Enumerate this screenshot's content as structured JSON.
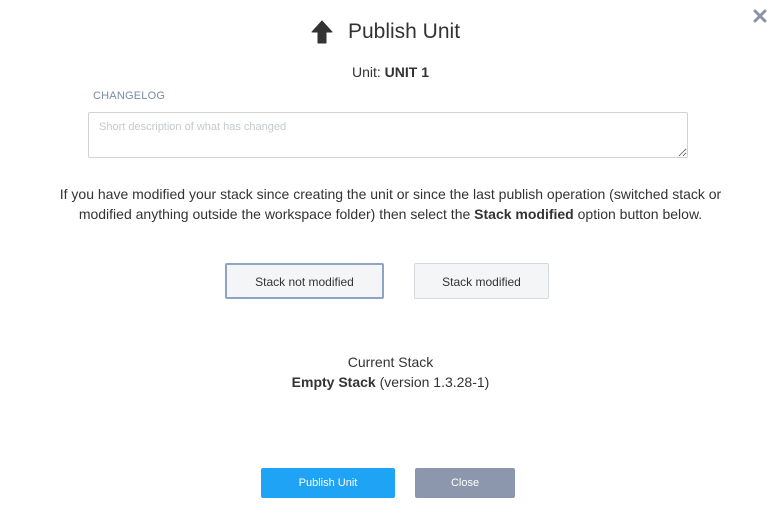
{
  "dialog": {
    "title": "Publish Unit",
    "title_icon": "arrow-up-icon",
    "close_icon": "close-icon"
  },
  "unit": {
    "label": "Unit:",
    "name": "UNIT 1"
  },
  "changelog": {
    "label": "CHANGELOG",
    "value": "",
    "placeholder": "Short description of what has changed"
  },
  "info": {
    "text_before": "If you have modified your stack since creating the unit or since the last publish operation (switched stack or modified anything outside the workspace folder) then select the ",
    "emphasis": "Stack modified",
    "text_after": " option button below."
  },
  "options": {
    "not_modified_label": "Stack not modified",
    "modified_label": "Stack modified",
    "selected": "Stack not modified"
  },
  "stack": {
    "label": "Current Stack",
    "name": "Empty Stack",
    "version": "(version 1.3.28-1)"
  },
  "buttons": {
    "publish_label": "Publish Unit",
    "close_label": "Close"
  },
  "colors": {
    "primary": "#1fa3f5",
    "secondary": "#8c97ad",
    "label_accent": "#7b8aa8",
    "selected_border": "#8ea4c4"
  }
}
